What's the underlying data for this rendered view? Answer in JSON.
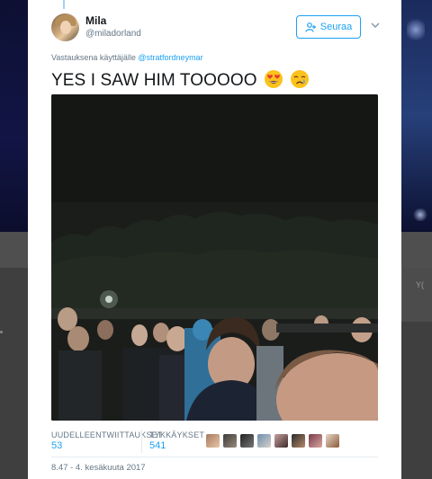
{
  "tweet": {
    "author_name": "Mila",
    "author_handle": "@miladorland",
    "follow_label": "Seuraa",
    "reply_prefix": "Vastauksena käyttäjälle",
    "reply_mention": "@stratfordneymar",
    "text": "YES I SAW HIM TOOOOO",
    "emojis": [
      "heart-eyes-emoji",
      "crying-emoji"
    ],
    "retweets_label": "UUDELLEENTWIITTAUKSET",
    "retweets_count": "53",
    "likes_label": "TYKKÄYKSET",
    "likes_count": "541",
    "liker_count": 8,
    "timestamp": "8.47 - 4. kesäkuuta 2017"
  },
  "background": {
    "card_text": "Y("
  },
  "colors": {
    "accent": "#1da1f2",
    "secondary_text": "#657786",
    "primary_text": "#14171a"
  }
}
